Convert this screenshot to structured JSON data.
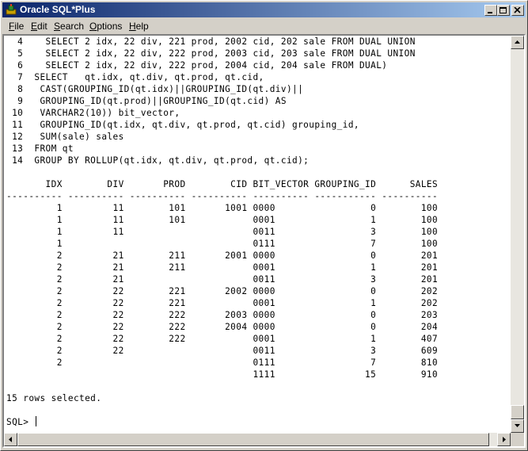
{
  "window": {
    "title": "Oracle SQL*Plus"
  },
  "menu": [
    {
      "label": "File",
      "underline": "F",
      "rest": "ile"
    },
    {
      "label": "Edit",
      "underline": "E",
      "rest": "dit"
    },
    {
      "label": "Search",
      "underline": "S",
      "rest": "earch"
    },
    {
      "label": "Options",
      "underline": "O",
      "rest": "ptions"
    },
    {
      "label": "Help",
      "underline": "H",
      "rest": "elp"
    }
  ],
  "console": {
    "lines": [
      "  4    SELECT 2 idx, 22 div, 221 prod, 2002 cid, 202 sale FROM DUAL UNION",
      "  5    SELECT 2 idx, 22 div, 222 prod, 2003 cid, 203 sale FROM DUAL UNION",
      "  6    SELECT 2 idx, 22 div, 222 prod, 2004 cid, 204 sale FROM DUAL)",
      "  7  SELECT   qt.idx, qt.div, qt.prod, qt.cid,",
      "  8   CAST(GROUPING_ID(qt.idx)||GROUPING_ID(qt.div)||",
      "  9   GROUPING_ID(qt.prod)||GROUPING_ID(qt.cid) AS",
      " 10   VARCHAR2(10)) bit_vector,",
      " 11   GROUPING_ID(qt.idx, qt.div, qt.prod, qt.cid) grouping_id,",
      " 12   SUM(sale) sales",
      " 13  FROM qt",
      " 14  GROUP BY ROLLUP(qt.idx, qt.div, qt.prod, qt.cid);",
      "",
      "       IDX        DIV       PROD        CID BIT_VECTOR GROUPING_ID      SALES",
      "---------- ---------- ---------- ---------- ---------- ----------- ----------",
      "         1         11        101       1001 0000                 0        100",
      "         1         11        101            0001                 1        100",
      "         1         11                       0011                 3        100",
      "         1                                  0111                 7        100",
      "         2         21        211       2001 0000                 0        201",
      "         2         21        211            0001                 1        201",
      "         2         21                       0011                 3        201",
      "         2         22        221       2002 0000                 0        202",
      "         2         22        221            0001                 1        202",
      "         2         22        222       2003 0000                 0        203",
      "         2         22        222       2004 0000                 0        204",
      "         2         22        222            0001                 1        407",
      "         2         22                       0011                 3        609",
      "         2                                  0111                 7        810",
      "                                            1111                15        910",
      "",
      "15 rows selected.",
      "",
      "SQL> "
    ]
  }
}
